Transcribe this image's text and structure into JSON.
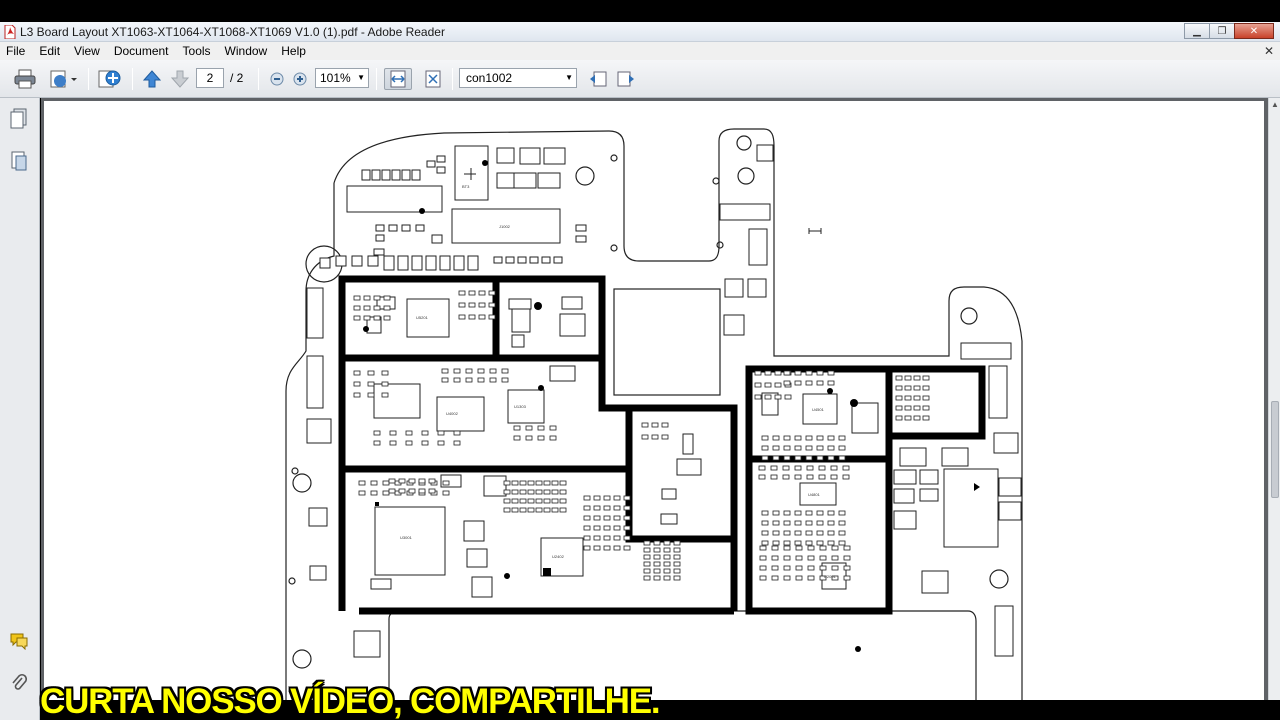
{
  "window": {
    "title": "L3 Board Layout XT1063-XT1064-XT1068-XT1069 V1.0 (1).pdf - Adobe Reader",
    "buttons": {
      "minimize": "▁",
      "restore": "❐",
      "close": "✕"
    }
  },
  "menu": {
    "items": [
      "File",
      "Edit",
      "View",
      "Document",
      "Tools",
      "Window",
      "Help"
    ],
    "close_doc": "✕"
  },
  "toolbar": {
    "current_page": "2",
    "total_pages": "/ 2",
    "zoom": "101%",
    "find_text": "con1002"
  },
  "left_panel": {
    "icons": [
      "pages-icon",
      "attachments-icon",
      "comments-icon",
      "paperclip-icon"
    ]
  },
  "board": {
    "labels": {
      "bt_text": "BT3",
      "u_main": "U5201",
      "u_pmic": "U4002",
      "u_rf": "U3001",
      "u_codec": "U2402",
      "u_small": "U1303",
      "u_right": "U4501",
      "u_right2": "U4801",
      "u_bottom_right": "U2001",
      "conn": "J1002"
    }
  },
  "overlay": {
    "subtitle": "CURTA NOSSO VÍDEO, COMPARTILHE."
  },
  "colors": {
    "subtitle": "#ffff00",
    "doc_bg": "#5f6266",
    "page_bg": "#ffffff",
    "shield_line": "#000000"
  }
}
